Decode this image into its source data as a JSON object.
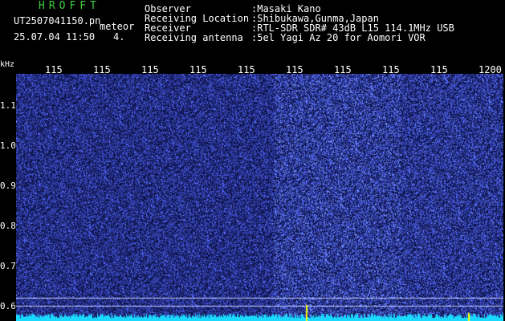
{
  "app": {
    "title": "HROFFT"
  },
  "file": {
    "name": "UT2507041150.pn",
    "type": "meteor",
    "datetime": "25.07.04 11:50",
    "count": "4."
  },
  "station": {
    "rows": [
      {
        "label": "Observer",
        "value": ":Masaki Kano"
      },
      {
        "label": "Receiving Location",
        "value": ":Shibukawa,Gunma,Japan"
      },
      {
        "label": "Receiver",
        "value": ":RTL-SDR SDR# 43dB L15 114.1MHz USB"
      },
      {
        "label": "Receiving antenna",
        "value": ":5el Yagi Az 20 for Aomori VOR"
      }
    ]
  },
  "spectrogram": {
    "unit": "kHz",
    "x_ticks": [
      "115",
      "115",
      "115",
      "115",
      "115",
      "115",
      "115",
      "115",
      "115",
      "1200"
    ],
    "y_ticks": [
      "1.1",
      "1.0",
      "0.9",
      "0.8",
      "0.7",
      "0.6"
    ],
    "colors": {
      "background": "#000033",
      "noise": "#2a3dff",
      "bright": "#9fb4ff",
      "baseline": "#1ad9ff",
      "marker": "#ffff00"
    }
  }
}
